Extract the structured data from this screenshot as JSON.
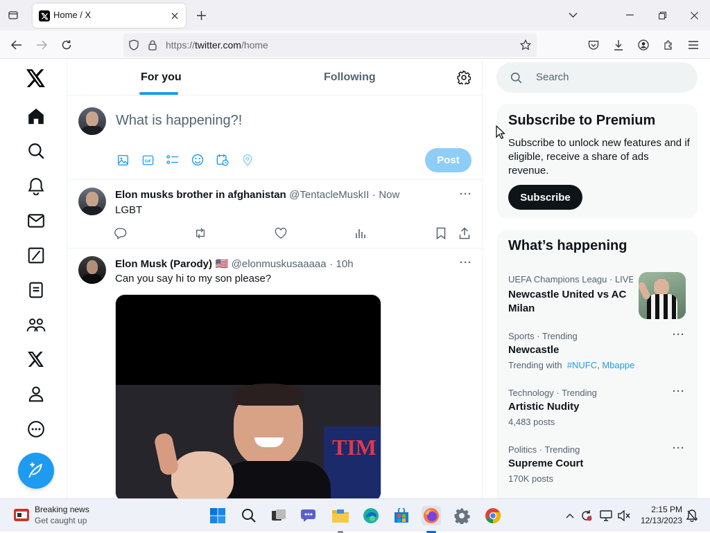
{
  "browser": {
    "tab_title": "Home / X",
    "url_scheme": "https://",
    "url_host": "twitter.com",
    "url_path": "/home"
  },
  "feed": {
    "tabs": [
      {
        "label": "For you",
        "active": true
      },
      {
        "label": "Following",
        "active": false
      }
    ],
    "composer": {
      "placeholder": "What is happening?!",
      "post_label": "Post"
    },
    "posts": [
      {
        "name": "Elon musks brother in afghanistan",
        "handle": "@TentacleMuskII",
        "time": "Now",
        "text": "LGBT",
        "flag": ""
      },
      {
        "name": "Elon Musk (Parody)",
        "handle": "@elonmuskusaaaaa",
        "time": "10h",
        "text": "Can you say hi to my son please?",
        "flag": "🇺🇸",
        "image_text": "TIM P"
      }
    ]
  },
  "sidebar": {
    "search_placeholder": "Search",
    "premium": {
      "title": "Subscribe to Premium",
      "body": "Subscribe to unlock new features and if eligible, receive a share of ads revenue.",
      "button": "Subscribe"
    },
    "happening": {
      "title": "What’s happening",
      "event": {
        "category": "UEFA Champions Leagu",
        "live": "· LIVE",
        "title": "Newcastle United vs AC Milan"
      },
      "trends": [
        {
          "category": "Sports · Trending",
          "title": "Newcastle",
          "sub_prefix": "Trending with",
          "sub_links": [
            "#NUFC",
            ", ",
            "Mbappe"
          ]
        },
        {
          "category": "Technology · Trending",
          "title": "Artistic Nudity",
          "sub": "4,483 posts"
        },
        {
          "category": "Politics · Trending",
          "title": "Supreme Court",
          "sub": "170K posts"
        }
      ]
    }
  },
  "taskbar": {
    "news_title": "Breaking news",
    "news_sub": "Get caught up",
    "time": "2:15 PM",
    "date": "12/13/2023"
  },
  "colors": {
    "accent": "#1d9bf0",
    "accent_disabled": "#8ecdf8",
    "text": "#0f1419",
    "muted": "#536471"
  }
}
